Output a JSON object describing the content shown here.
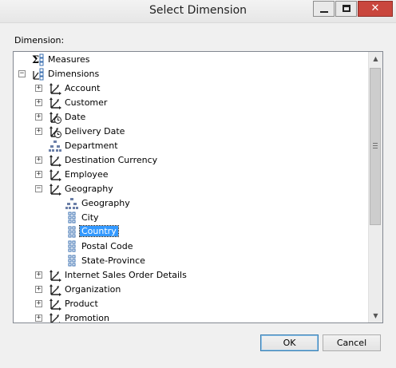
{
  "window": {
    "title": "Select Dimension"
  },
  "dimension_label": "Dimension:",
  "tree": [
    {
      "label": "Measures",
      "icon": "measures-icon",
      "level": 0,
      "expander": null
    },
    {
      "label": "Dimensions",
      "icon": "dimensions-icon",
      "level": 0,
      "expander": "−"
    },
    {
      "label": "Account",
      "icon": "dimension-icon",
      "level": 1,
      "expander": "+"
    },
    {
      "label": "Customer",
      "icon": "dimension-icon",
      "level": 1,
      "expander": "+"
    },
    {
      "label": "Date",
      "icon": "time-dimension-icon",
      "level": 1,
      "expander": "+"
    },
    {
      "label": "Delivery Date",
      "icon": "time-dimension-icon",
      "level": 1,
      "expander": "+"
    },
    {
      "label": "Department",
      "icon": "hierarchy-icon",
      "level": 1,
      "expander": null
    },
    {
      "label": "Destination Currency",
      "icon": "dimension-icon",
      "level": 1,
      "expander": "+"
    },
    {
      "label": "Employee",
      "icon": "dimension-icon",
      "level": 1,
      "expander": "+"
    },
    {
      "label": "Geography",
      "icon": "dimension-icon",
      "level": 1,
      "expander": "−"
    },
    {
      "label": "Geography",
      "icon": "hierarchy-icon",
      "level": 2,
      "expander": null
    },
    {
      "label": "City",
      "icon": "attribute-icon",
      "level": 2,
      "expander": null
    },
    {
      "label": "Country",
      "icon": "attribute-icon",
      "level": 2,
      "expander": null,
      "selected": true
    },
    {
      "label": "Postal Code",
      "icon": "attribute-icon",
      "level": 2,
      "expander": null
    },
    {
      "label": "State-Province",
      "icon": "attribute-icon",
      "level": 2,
      "expander": null
    },
    {
      "label": "Internet Sales Order Details",
      "icon": "dimension-icon",
      "level": 1,
      "expander": "+"
    },
    {
      "label": "Organization",
      "icon": "dimension-icon",
      "level": 1,
      "expander": "+"
    },
    {
      "label": "Product",
      "icon": "dimension-icon",
      "level": 1,
      "expander": "+"
    },
    {
      "label": "Promotion",
      "icon": "dimension-icon",
      "level": 1,
      "expander": "+"
    }
  ],
  "buttons": {
    "ok": "OK",
    "cancel": "Cancel"
  },
  "colors": {
    "selection": "#3399ff",
    "close_button": "#c9463d"
  }
}
